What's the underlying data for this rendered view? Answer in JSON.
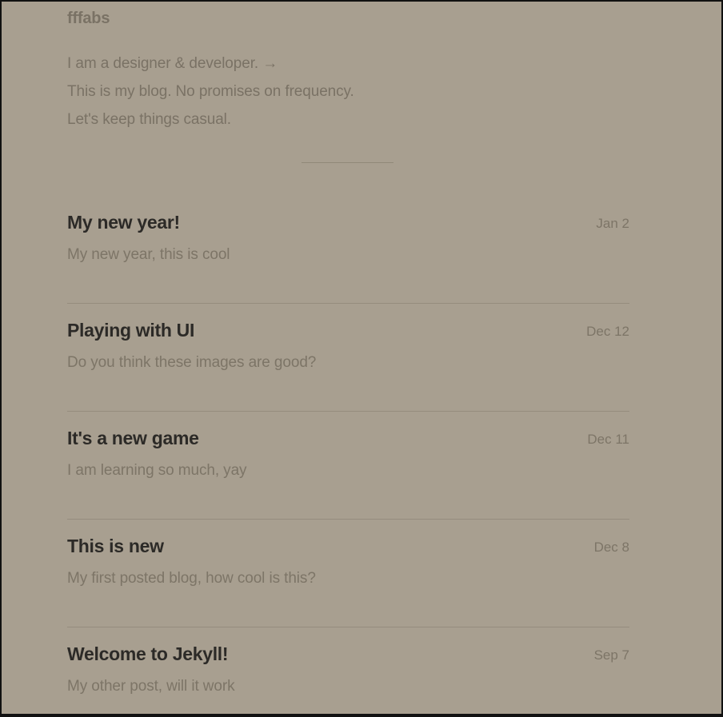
{
  "site": {
    "title": "fffabs",
    "intro": {
      "line1": "I am a designer & developer. →",
      "line2": "This is my blog. No promises on frequency.",
      "line3": "Let's keep things casual."
    }
  },
  "posts": [
    {
      "title": "My new year!",
      "date": "Jan 2",
      "excerpt": "My new year, this is cool"
    },
    {
      "title": "Playing with UI",
      "date": "Dec 12",
      "excerpt": "Do you think these images are good?"
    },
    {
      "title": "It's a new game",
      "date": "Dec 11",
      "excerpt": "I am learning so much, yay"
    },
    {
      "title": "This is new",
      "date": "Dec 8",
      "excerpt": "My first posted blog, how cool is this?"
    },
    {
      "title": "Welcome to Jekyll!",
      "date": "Sep 7",
      "excerpt": "My other post, will it work"
    }
  ]
}
